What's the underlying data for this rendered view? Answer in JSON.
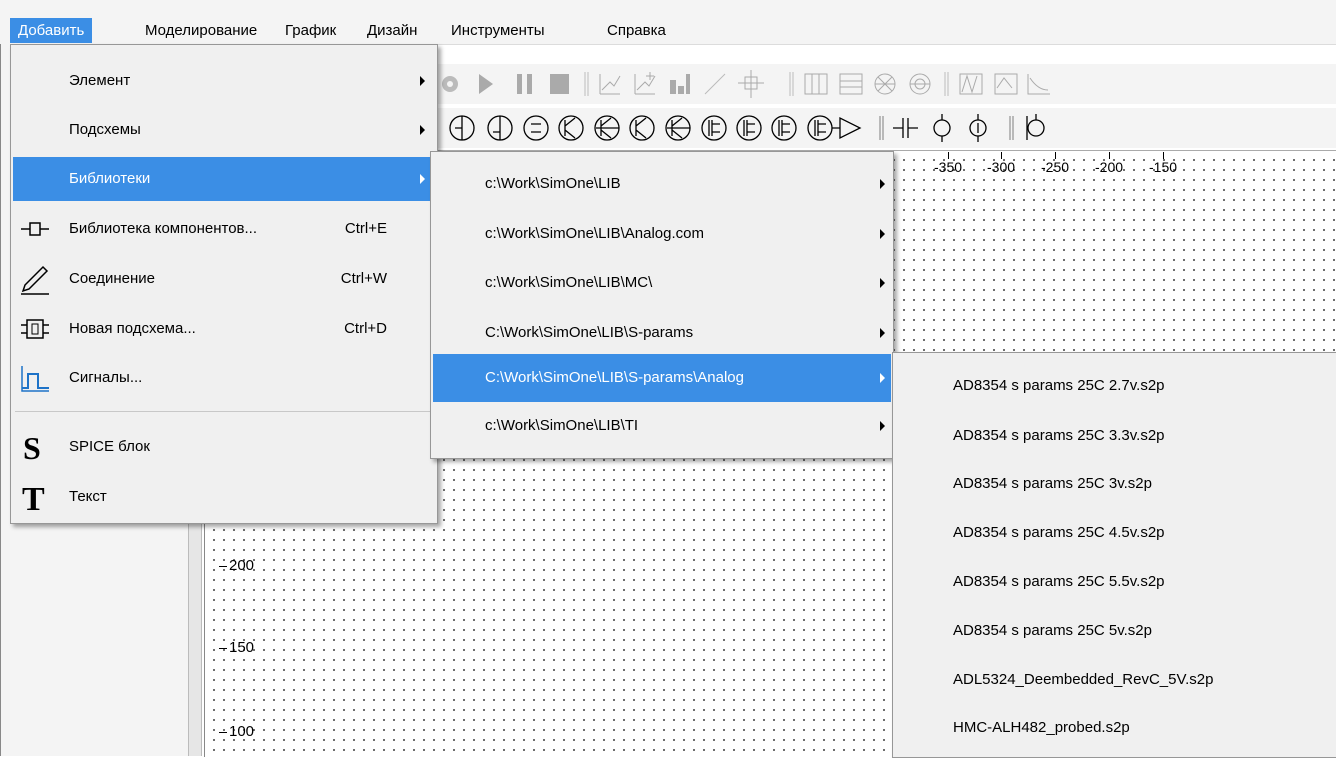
{
  "menubar": {
    "items": [
      "Добавить",
      "Моделирование",
      "График",
      "Дизайн",
      "Инструменты",
      "Справка"
    ]
  },
  "canvas": {
    "x_ticks": [
      "-350",
      "-300",
      "-250",
      "-200",
      "-150"
    ],
    "y_ticks": [
      "200",
      "150",
      "100"
    ]
  },
  "add_menu": {
    "items": [
      {
        "label": "Элемент",
        "submenu": true
      },
      {
        "label": "Подсхемы",
        "submenu": true
      },
      {
        "label": "Библиотеки",
        "submenu": true
      },
      {
        "label": "Библиотека компонентов...",
        "shortcut": "Ctrl+E",
        "icon": "component-library-icon"
      },
      {
        "label": "Соединение",
        "shortcut": "Ctrl+W",
        "icon": "pencil-icon"
      },
      {
        "label": "Новая подсхема...",
        "shortcut": "Ctrl+D",
        "icon": "subcircuit-icon"
      },
      {
        "label": "Сигналы...",
        "icon": "pulse-signal-icon"
      },
      {
        "label": "SPICE блок",
        "icon": "spice-s-icon"
      },
      {
        "label": "Текст",
        "icon": "text-t-icon"
      }
    ]
  },
  "libraries_menu": {
    "items": [
      "c:\\Work\\SimOne\\LIB",
      "c:\\Work\\SimOne\\LIB\\Analog.com",
      "c:\\Work\\SimOne\\LIB\\MC\\",
      "C:\\Work\\SimOne\\LIB\\S-params",
      "C:\\Work\\SimOne\\LIB\\S-params\\Analog",
      "c:\\Work\\SimOne\\LIB\\TI"
    ]
  },
  "files_menu": {
    "items": [
      "AD8354 s params 25C  2.7v.s2p",
      "AD8354 s params 25C  3.3v.s2p",
      "AD8354 s params 25C  3v.s2p",
      "AD8354 s params 25C  4.5v.s2p",
      "AD8354 s params 25C  5.5v.s2p",
      "AD8354 s params 25C  5v.s2p",
      "ADL5324_Deembedded_RevC_5V.s2p",
      "HMC-ALH482_probed.s2p"
    ]
  },
  "colors": {
    "highlight": "#3b8ee5",
    "menu_bg": "#f0f0f0"
  }
}
